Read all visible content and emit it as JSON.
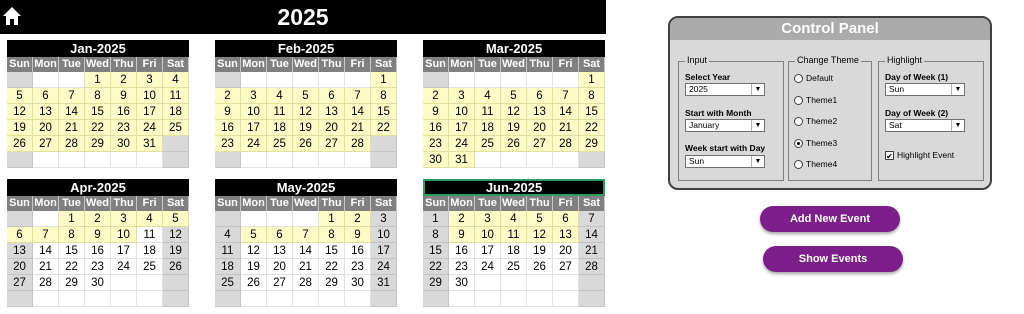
{
  "header": {
    "year": "2025"
  },
  "weekdays": [
    "Sun",
    "Mon",
    "Tue",
    "Wed",
    "Thu",
    "Fri",
    "Sat"
  ],
  "months": [
    {
      "title": "Jan-2025",
      "rows": [
        [
          "",
          "",
          "",
          "1",
          "2",
          "3",
          "4"
        ],
        [
          "5",
          "6",
          "7",
          "8",
          "9",
          "10",
          "11"
        ],
        [
          "12",
          "13",
          "14",
          "15",
          "16",
          "17",
          "18"
        ],
        [
          "19",
          "20",
          "21",
          "22",
          "23",
          "24",
          "25"
        ],
        [
          "26",
          "27",
          "28",
          "29",
          "30",
          "31",
          ""
        ],
        [
          "",
          "",
          "",
          "",
          "",
          "",
          ""
        ]
      ]
    },
    {
      "title": "Feb-2025",
      "rows": [
        [
          "",
          "",
          "",
          "",
          "",
          "",
          "1"
        ],
        [
          "2",
          "3",
          "4",
          "5",
          "6",
          "7",
          "8"
        ],
        [
          "9",
          "10",
          "11",
          "12",
          "13",
          "14",
          "15"
        ],
        [
          "16",
          "17",
          "18",
          "19",
          "20",
          "21",
          "22"
        ],
        [
          "23",
          "24",
          "25",
          "26",
          "27",
          "28",
          ""
        ],
        [
          "",
          "",
          "",
          "",
          "",
          "",
          ""
        ]
      ]
    },
    {
      "title": "Mar-2025",
      "rows": [
        [
          "",
          "",
          "",
          "",
          "",
          "",
          "1"
        ],
        [
          "2",
          "3",
          "4",
          "5",
          "6",
          "7",
          "8"
        ],
        [
          "9",
          "10",
          "11",
          "12",
          "13",
          "14",
          "15"
        ],
        [
          "16",
          "17",
          "18",
          "19",
          "20",
          "21",
          "22"
        ],
        [
          "23",
          "24",
          "25",
          "26",
          "27",
          "28",
          "29"
        ],
        [
          "30",
          "31",
          "",
          "",
          "",
          "",
          ""
        ]
      ]
    },
    {
      "title": "Apr-2025",
      "rows": [
        [
          "",
          "",
          "1",
          "2",
          "3",
          "4",
          "5"
        ],
        [
          "6",
          "7",
          "8",
          "9",
          "10",
          "11",
          "12"
        ],
        [
          "13",
          "14",
          "15",
          "16",
          "17",
          "18",
          "19"
        ],
        [
          "20",
          "21",
          "22",
          "23",
          "24",
          "25",
          "26"
        ],
        [
          "27",
          "28",
          "29",
          "30",
          "",
          "",
          ""
        ],
        [
          "",
          "",
          "",
          "",
          "",
          "",
          ""
        ]
      ]
    },
    {
      "title": "May-2025",
      "rows": [
        [
          "",
          "",
          "",
          "",
          "1",
          "2",
          "3"
        ],
        [
          "4",
          "5",
          "6",
          "7",
          "8",
          "9",
          "10"
        ],
        [
          "11",
          "12",
          "13",
          "14",
          "15",
          "16",
          "17"
        ],
        [
          "18",
          "19",
          "20",
          "21",
          "22",
          "23",
          "24"
        ],
        [
          "25",
          "26",
          "27",
          "28",
          "29",
          "30",
          "31"
        ],
        [
          "",
          "",
          "",
          "",
          "",
          "",
          ""
        ]
      ]
    },
    {
      "title": "Jun-2025",
      "rows": [
        [
          "1",
          "2",
          "3",
          "4",
          "5",
          "6",
          "7"
        ],
        [
          "8",
          "9",
          "10",
          "11",
          "12",
          "13",
          "14"
        ],
        [
          "15",
          "16",
          "17",
          "18",
          "19",
          "20",
          "21"
        ],
        [
          "22",
          "23",
          "24",
          "25",
          "26",
          "27",
          "28"
        ],
        [
          "29",
          "30",
          "",
          "",
          "",
          "",
          ""
        ],
        [
          "",
          "",
          "",
          "",
          "",
          "",
          ""
        ]
      ]
    }
  ],
  "control_panel": {
    "title": "Control Panel",
    "input": {
      "title": "Input",
      "select_year_label": "Select Year",
      "select_year_value": "2025",
      "start_month_label": "Start with Month",
      "start_month_value": "January",
      "week_start_label": "Week start with Day",
      "week_start_value": "Sun"
    },
    "theme": {
      "title": "Change Theme",
      "options": [
        "Default",
        "Theme1",
        "Theme2",
        "Theme3",
        "Theme4"
      ],
      "selected": "Theme3"
    },
    "highlight": {
      "title": "Highlight",
      "dow1_label": "Day of Week (1)",
      "dow1_value": "Sun",
      "dow2_label": "Day of Week (2)",
      "dow2_value": "Sat",
      "checkbox_label": "Highlight Event",
      "checkbox_checked": true
    }
  },
  "buttons": {
    "add_event": "Add New Event",
    "show_events": "Show Events"
  },
  "colors": {
    "highlight": "#fdfcc7",
    "weekend": "#d9d9d9",
    "header": "#808080",
    "button": "#7d1f8a"
  }
}
